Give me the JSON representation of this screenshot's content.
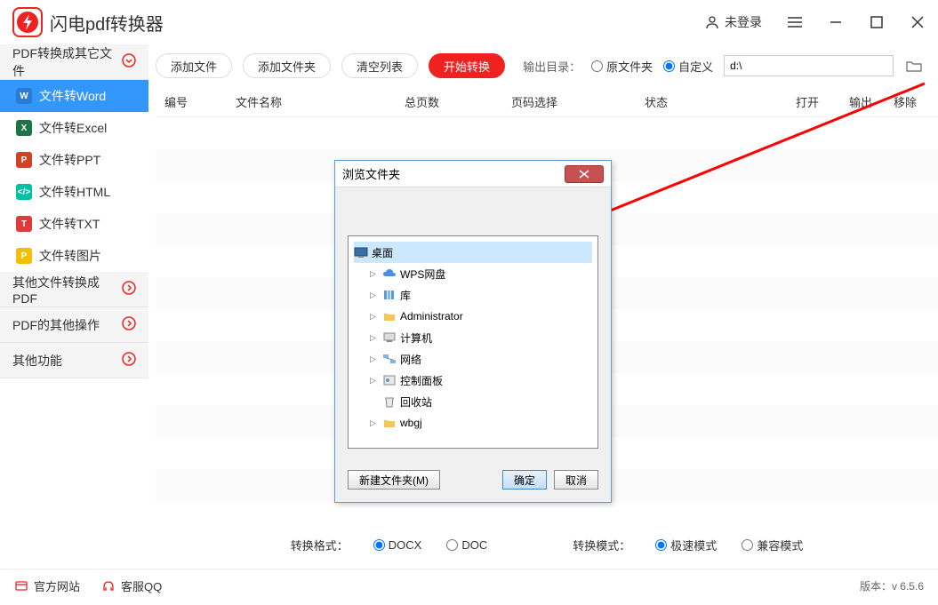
{
  "app": {
    "title": "闪电pdf转换器",
    "login_text": "未登录"
  },
  "sidebar": {
    "group1": "PDF转换成其它文件",
    "items": [
      {
        "label": "文件转Word"
      },
      {
        "label": "文件转Excel"
      },
      {
        "label": "文件转PPT"
      },
      {
        "label": "文件转HTML"
      },
      {
        "label": "文件转TXT"
      },
      {
        "label": "文件转图片"
      }
    ],
    "group2": "其他文件转换成PDF",
    "group3": "PDF的其他操作",
    "group4": "其他功能"
  },
  "toolbar": {
    "add_file": "添加文件",
    "add_folder": "添加文件夹",
    "clear": "清空列表",
    "start": "开始转换",
    "out_label": "输出目录：",
    "opt_src": "原文件夹",
    "opt_custom": "自定义",
    "path_value": "d:\\"
  },
  "columns": {
    "num": "编号",
    "name": "文件名称",
    "pages": "总页数",
    "range": "页码选择",
    "status": "状态",
    "open": "打开",
    "output": "输出",
    "remove": "移除"
  },
  "bottom": {
    "fmt_label": "转换格式：",
    "fmt1": "DOCX",
    "fmt2": "DOC",
    "mode_label": "转换模式：",
    "mode1": "极速模式",
    "mode2": "兼容模式"
  },
  "footer": {
    "site": "官方网站",
    "qq": "客服QQ",
    "version_label": "版本：",
    "version": "v 6.5.6"
  },
  "dialog": {
    "title": "浏览文件夹",
    "tree": [
      {
        "label": "桌面"
      },
      {
        "label": "WPS网盘"
      },
      {
        "label": "库"
      },
      {
        "label": "Administrator"
      },
      {
        "label": "计算机"
      },
      {
        "label": "网络"
      },
      {
        "label": "控制面板"
      },
      {
        "label": "回收站"
      },
      {
        "label": "wbgj"
      }
    ],
    "new_folder": "新建文件夹(M)",
    "ok": "确定",
    "cancel": "取消"
  }
}
